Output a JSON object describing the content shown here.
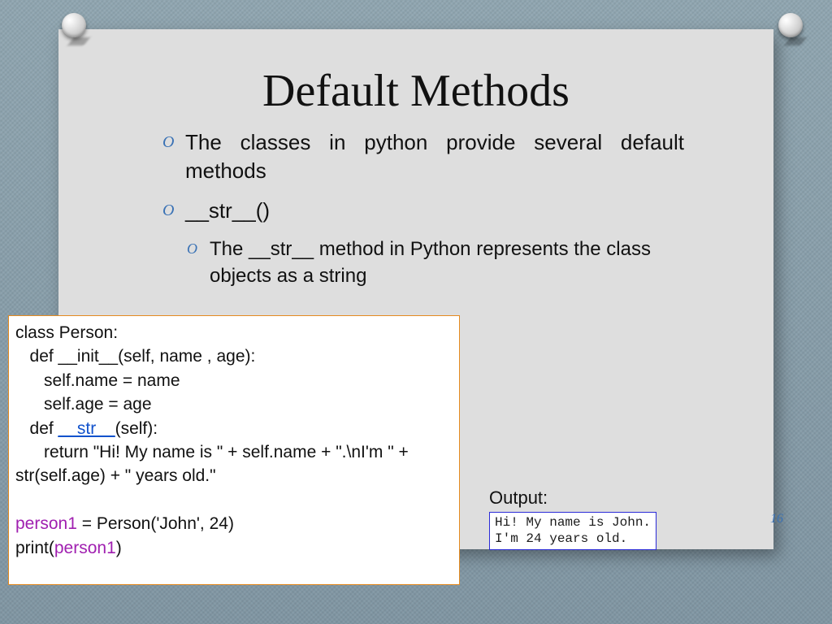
{
  "title": "Default Methods",
  "bullets": {
    "b1": "The classes in python provide several default methods",
    "b2": "__str__()",
    "b3": "The __str__ method in Python represents the class objects as a string"
  },
  "code": {
    "l1": "class Person:",
    "l2": "   def __init__(self, name , age):",
    "l3": "      self.name = name",
    "l4": "      self.age = age",
    "l5a": "   def ",
    "l5b": "__str__",
    "l5c": "(self):",
    "l6": "      return \"Hi! My name is \" + self.name + \".\\nI'm \" + str(self.age) + \" years old.\"",
    "l7": "",
    "l8a": "person1",
    "l8b": " = Person('John', 24)",
    "l9a": "print(",
    "l9b": "person1",
    "l9c": ")"
  },
  "output": {
    "label": "Output:",
    "text": "Hi! My name is John.\nI'm 24 years old."
  },
  "page_number": "16"
}
